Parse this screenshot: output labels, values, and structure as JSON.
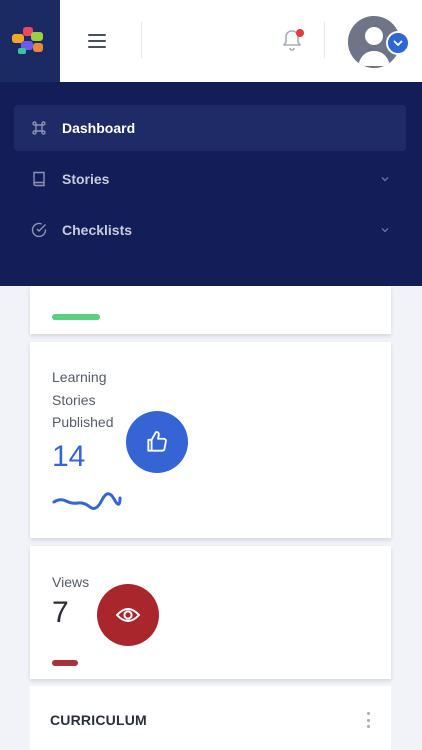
{
  "header": {
    "logo_icon": "puzzle-logo-icon",
    "menu_icon": "hamburger-icon",
    "notification_icon": "bell-icon",
    "notification_dot_color": "#e23c3c",
    "avatar_icon": "user-avatar-icon",
    "avatar_dropdown_icon": "chevron-down-icon"
  },
  "nav": {
    "items": [
      {
        "label": "Dashboard",
        "icon": "command-icon",
        "active": true
      },
      {
        "label": "Stories",
        "icon": "book-icon",
        "has_chevron": true
      },
      {
        "label": "Checklists",
        "icon": "check-circle-icon",
        "has_chevron": true
      }
    ]
  },
  "cards": {
    "stories": {
      "label_line1": "Learning",
      "label_line2": "Stories",
      "label_line3": "Published",
      "value": "14",
      "icon": "thumbs-up-icon",
      "accent": "#3565d4"
    },
    "views": {
      "label": "Views",
      "value": "7",
      "icon": "eye-icon",
      "accent": "#a8262c"
    },
    "curriculum": {
      "title": "CURRICULUM",
      "menu_icon": "more-vertical-icon"
    }
  },
  "colors": {
    "nav_bg": "#131d57",
    "logo_bg": "#1b2a63",
    "page_bg": "#f2f3f8"
  }
}
